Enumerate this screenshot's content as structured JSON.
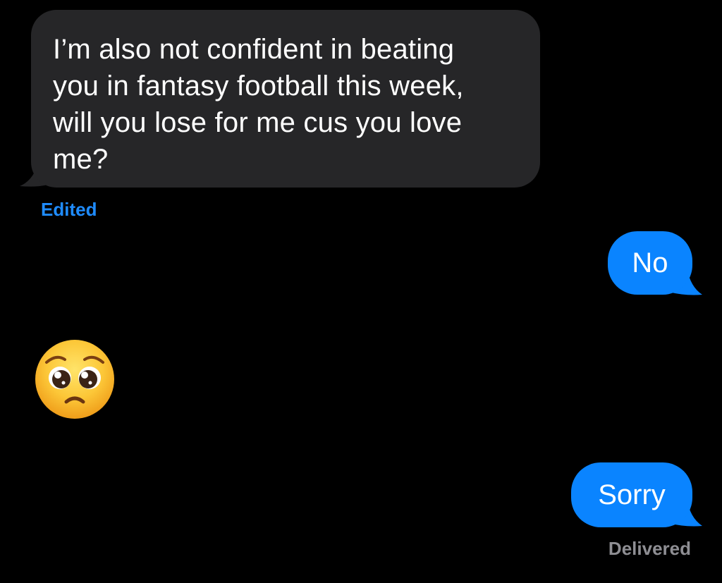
{
  "thread": {
    "incoming_message": "I’m also not confident in beating\nyou in fantasy football this week,\nwill you lose for me cus you love\nme?",
    "incoming_status": "Edited",
    "outgoing_message_1": "No",
    "reaction_emoji": "pleading-face",
    "outgoing_message_2": "Sorry",
    "delivery_status": "Delivered"
  },
  "colors": {
    "background": "#000000",
    "incoming_bubble": "#262628",
    "outgoing_bubble": "#0a84ff",
    "edited_text": "#1f8cff",
    "status_text": "#8e8e93"
  }
}
